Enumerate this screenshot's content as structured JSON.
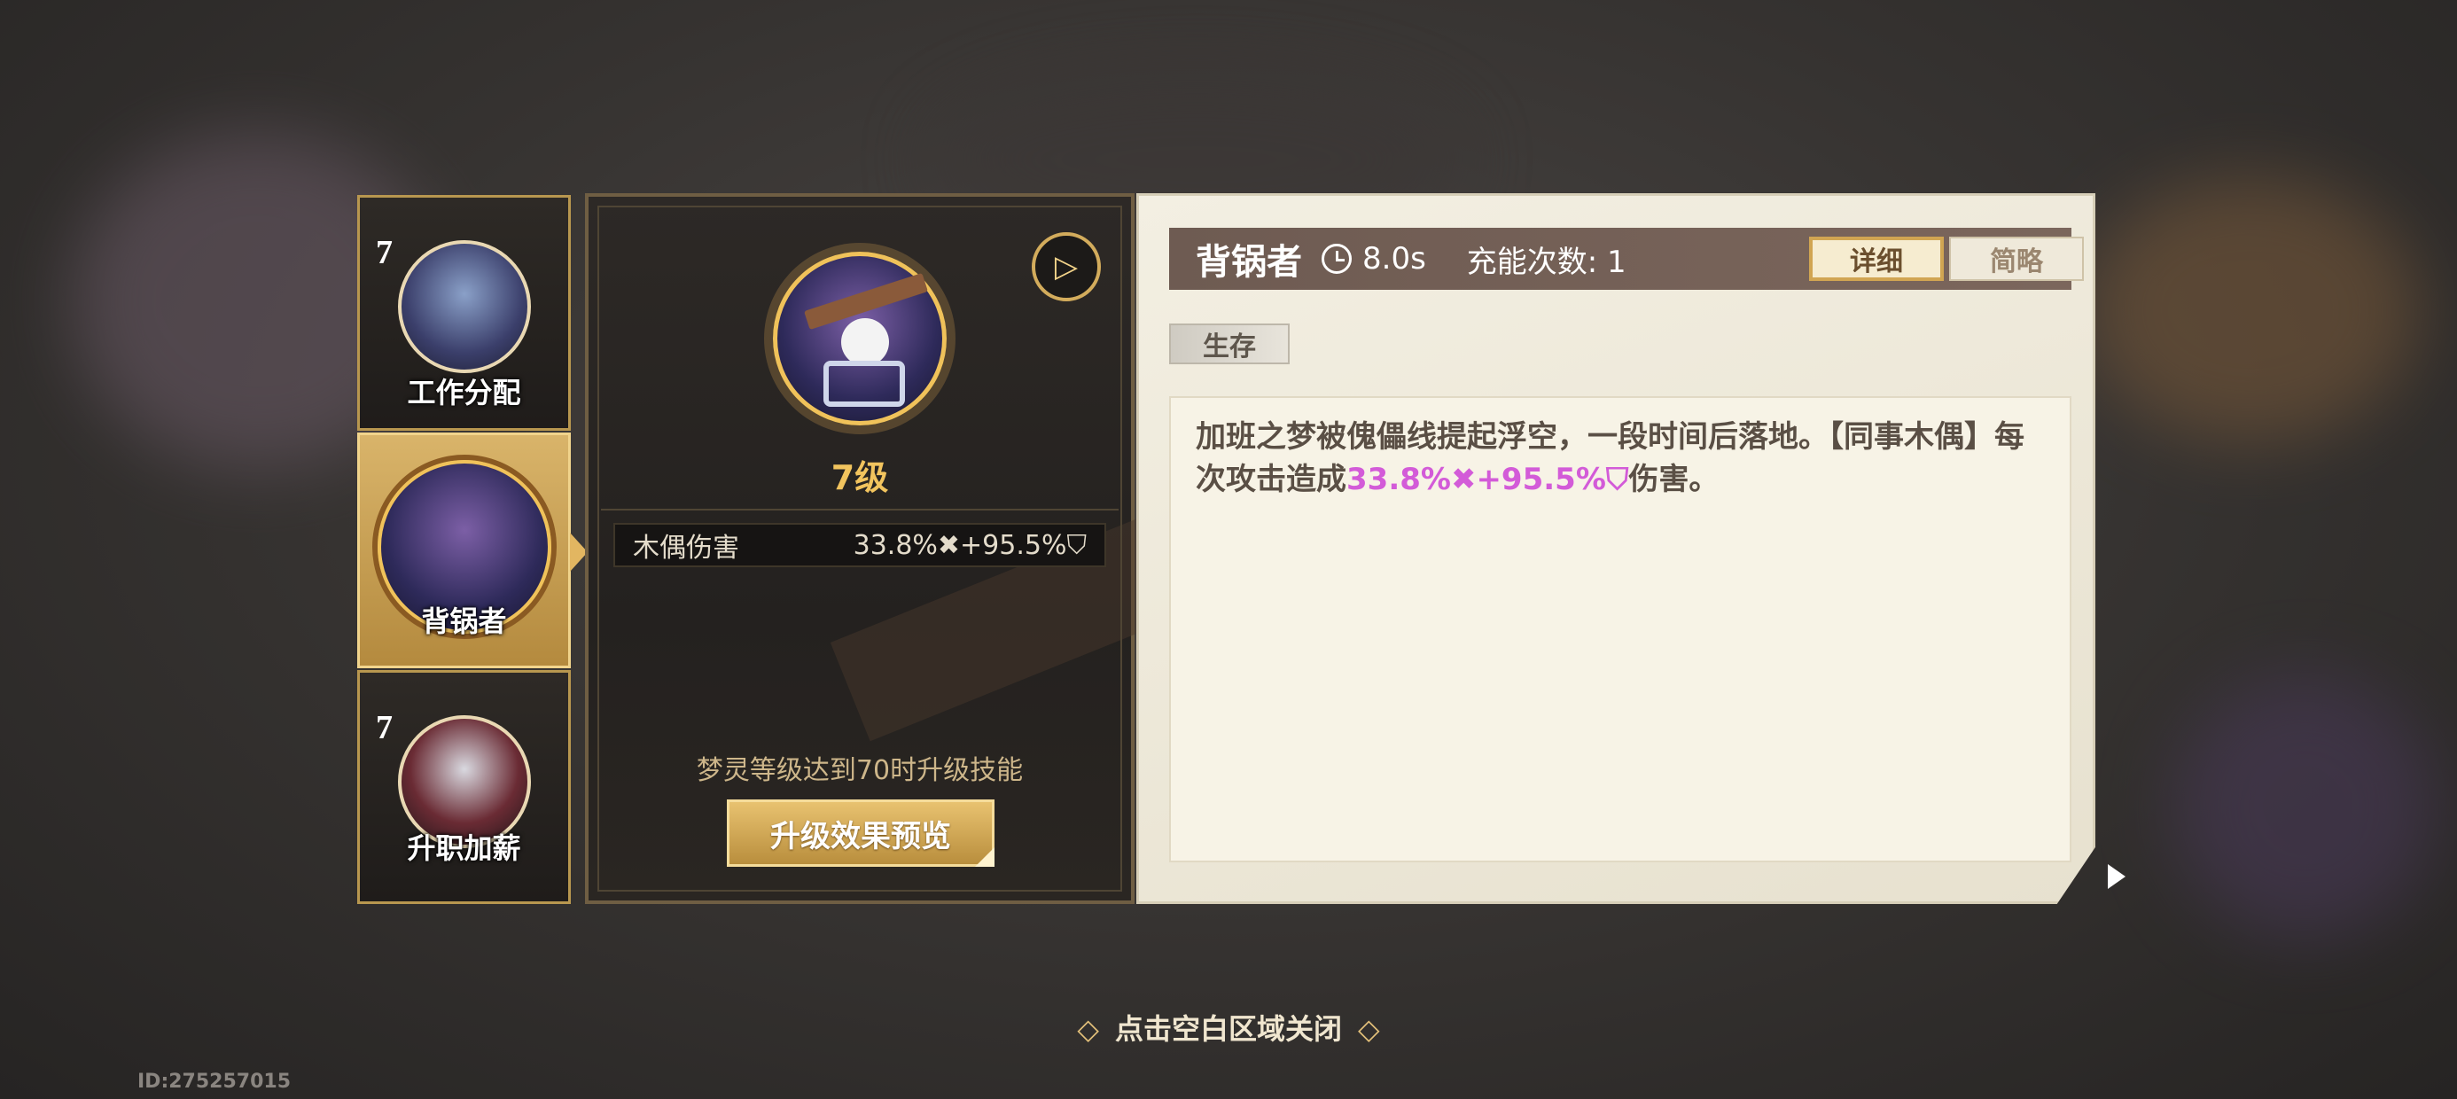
{
  "skills": [
    {
      "level": "7",
      "name": "工作分配"
    },
    {
      "level": "",
      "name": "背锅者"
    },
    {
      "level": "7",
      "name": "升职加薪"
    }
  ],
  "middle": {
    "level_text": "7级",
    "stat_label": "木偶伤害",
    "stat_value": "33.8%✖+95.5%⛉",
    "hint": "梦灵等级达到70时升级技能",
    "preview_button": "升级效果预览"
  },
  "detail": {
    "name": "背锅者",
    "cooldown": "8.0s",
    "charges": "充能次数: 1",
    "tab_detail": "详细",
    "tab_brief": "简略",
    "tag": "生存",
    "desc_part1": "加班之梦被傀儡线提起浮空，一段时间后落地。【同事木偶】每次攻击造成",
    "desc_highlight": "33.8%✖+95.5%⛉",
    "desc_part2": "伤害。"
  },
  "footer": {
    "close_hint": "点击空白区域关闭",
    "id": "ID:275257015"
  },
  "colors": {
    "accent_gold": "#f2c45e",
    "highlight_pink": "#d35bd8",
    "title_bar": "#6e5b52"
  }
}
